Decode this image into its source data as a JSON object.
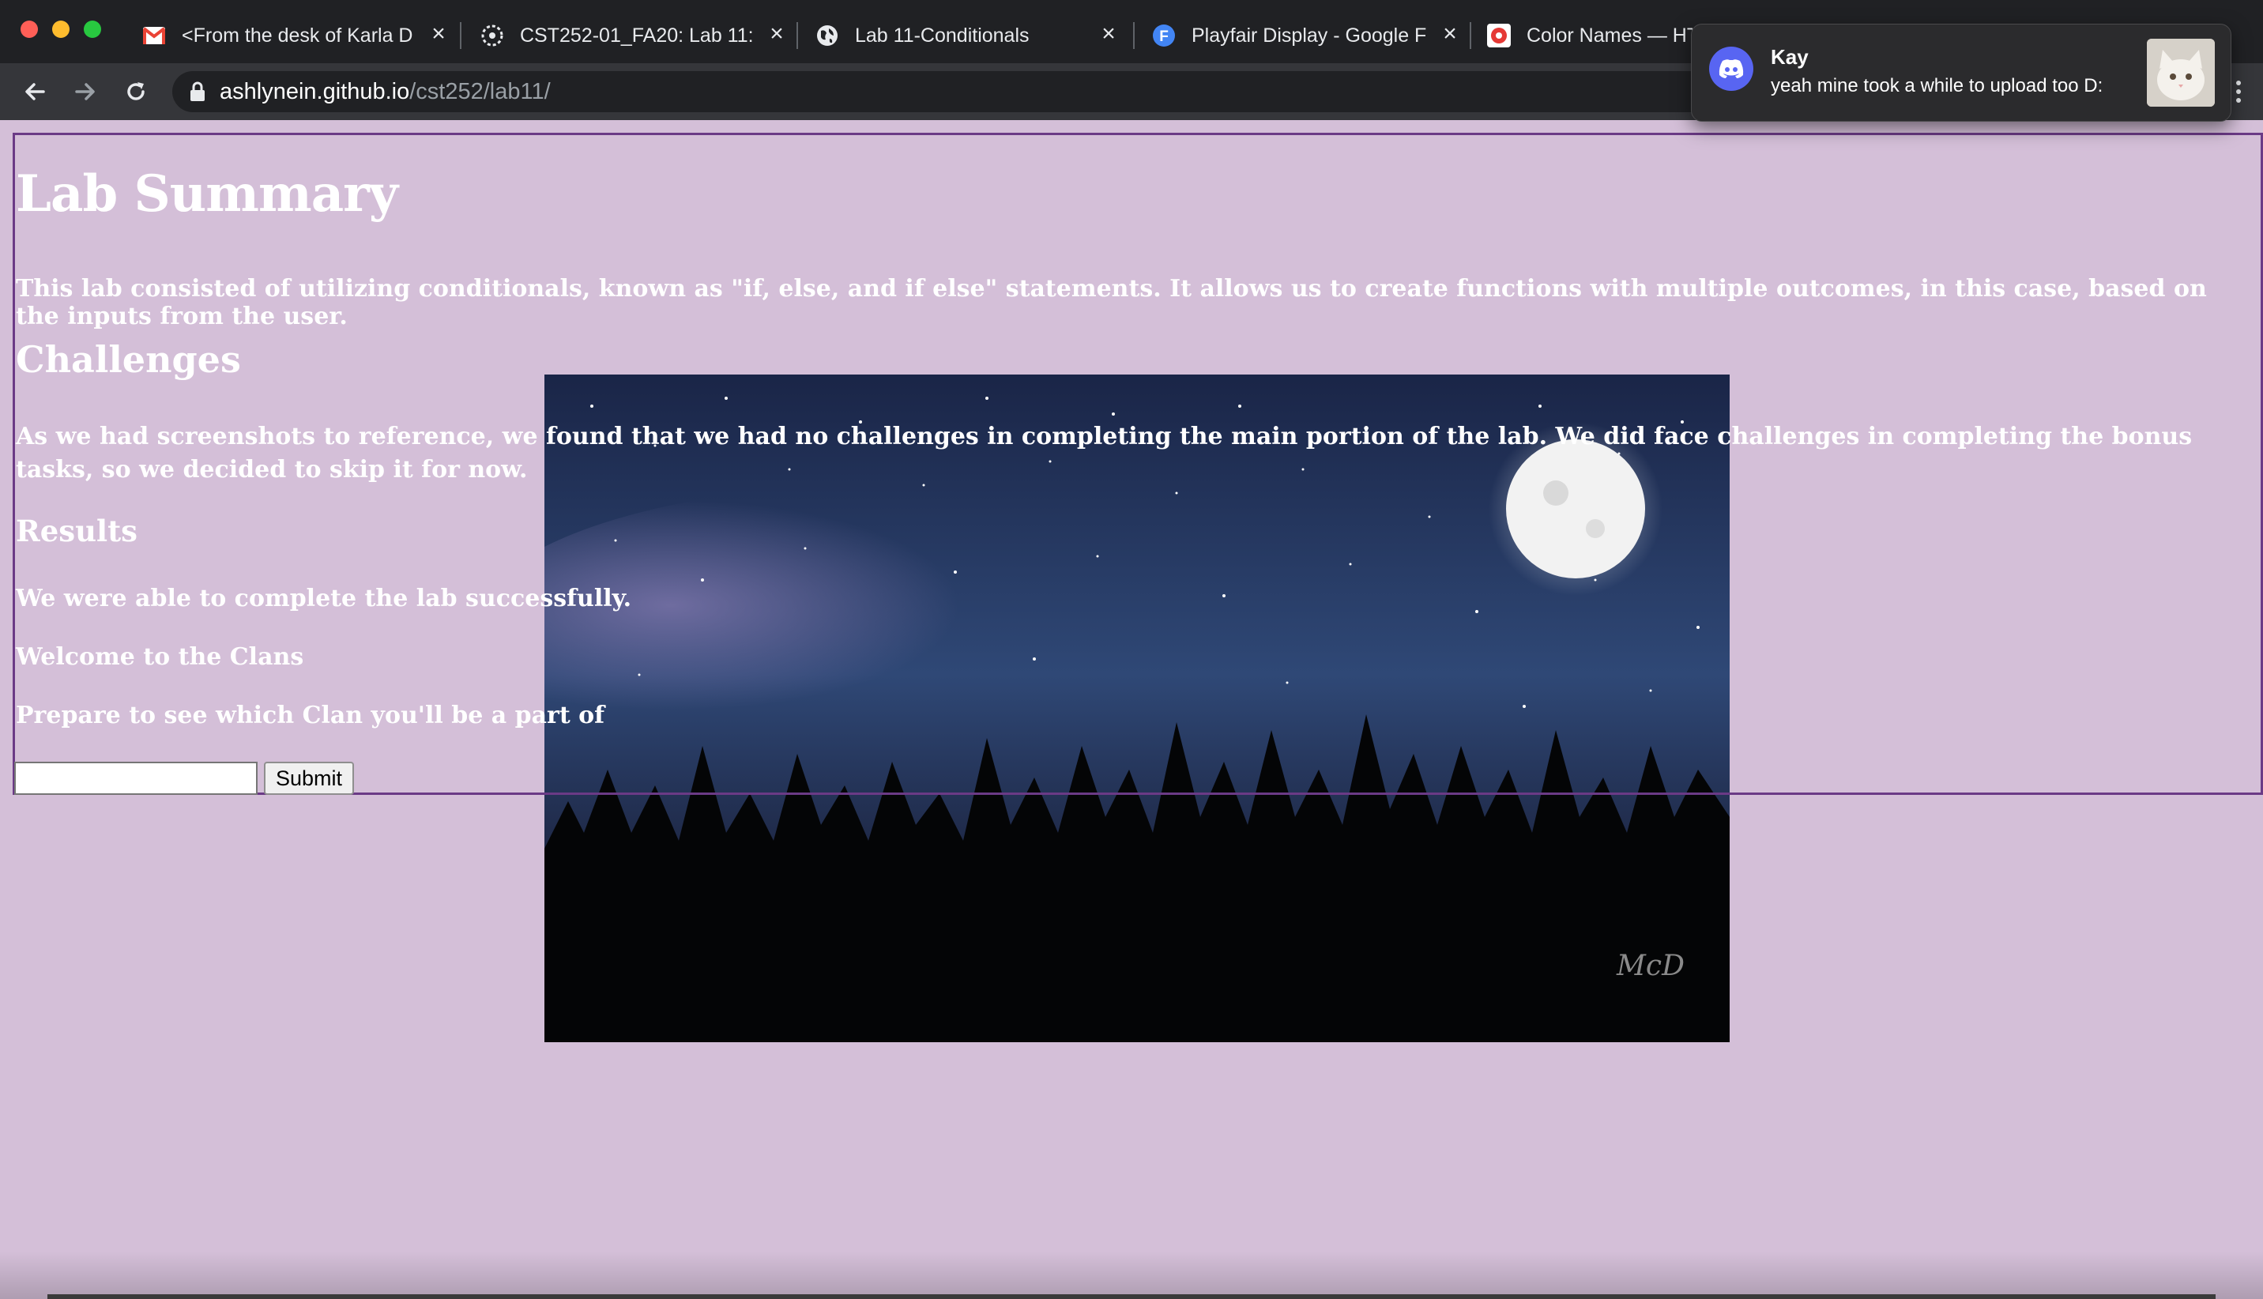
{
  "browser": {
    "tabs": [
      {
        "title": "<From the desk of Karla D",
        "icon": "gmail-icon"
      },
      {
        "title": "CST252-01_FA20: Lab 11:",
        "icon": "canvas-icon"
      },
      {
        "title": "Lab 11-Conditionals",
        "icon": "globe-icon"
      },
      {
        "title": "Playfair Display - Google F",
        "icon": "google-fonts-icon"
      },
      {
        "title": "Color Names — HT",
        "icon": "html-color-icon"
      }
    ],
    "url_host": "ashlynein.github.io",
    "url_path": "/cst252/lab11/"
  },
  "notification": {
    "sender": "Kay",
    "message": "yeah mine took a while to upload too D:",
    "app_icon": "discord-icon"
  },
  "page": {
    "background_color": "#d4bfd8",
    "heading": "Lab Summary",
    "summary": "This lab consisted of utilizing conditionals, known as \"if, else, and if else\" statements. It allows us to create functions with multiple outcomes, in this case, based on the inputs from the user.",
    "challenges_heading": "Challenges",
    "challenges_text": "As we had screenshots to reference, we found that we had no challenges in completing the main portion of the lab. We did face challenges in completing the bonus tasks, so we decided to skip it for now.",
    "results_heading": "Results",
    "results_text": "We were able to complete the lab successfully.",
    "welcome_text": "Welcome to the Clans",
    "prepare_text": "Prepare to see which Clan you'll be a part of",
    "input_value": "",
    "submit_label": "Submit"
  }
}
